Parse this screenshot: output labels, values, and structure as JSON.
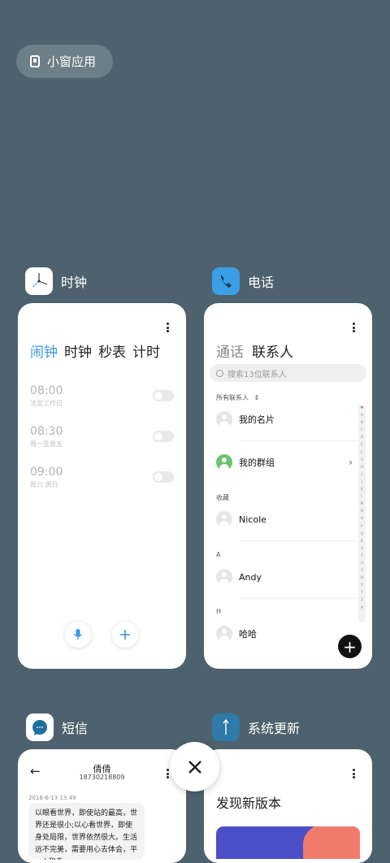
{
  "floating_window": {
    "label": "小窗应用"
  },
  "apps": {
    "clock": {
      "name": "时钟",
      "tabs": [
        "闹钟",
        "时钟",
        "秒表",
        "计时"
      ],
      "alarms": [
        {
          "time": "08:00",
          "desc": "法定工作日",
          "on": false
        },
        {
          "time": "08:30",
          "desc": "周一至周五",
          "on": false
        },
        {
          "time": "09:00",
          "desc": "周六 周日",
          "on": false
        }
      ]
    },
    "phone": {
      "name": "电话",
      "tabs": [
        "通话",
        "联系人"
      ],
      "search_placeholder": "搜索13位联系人",
      "section_all": "所有联系人",
      "my_card": "我的名片",
      "my_groups": "我的群组",
      "section_fav": "收藏",
      "contact_nicole": "Nicole",
      "section_a": "A",
      "contact_andy": "Andy",
      "section_h": "H",
      "contact_haha": "哈哈",
      "index_letters": [
        "♥",
        "A",
        "B",
        "C",
        "D",
        "E",
        "F",
        "G",
        "H",
        "I",
        "J",
        "K",
        "L",
        "M",
        "N",
        "O",
        "P",
        "Q",
        "R",
        "S",
        "T",
        "U",
        "V",
        "W",
        "X",
        "Y",
        "Z",
        "#"
      ]
    },
    "sms": {
      "name": "短信",
      "contact": "倩倩",
      "number": "18730218809",
      "date": "2016-6-13 13:49",
      "message": "以眼看世界，即使站的最高，世界还是很小;以心看世界，即使身处局限，世界依然很大。生活远不完美，需要用心去体会，平unk和去"
    },
    "update": {
      "name": "系统更新",
      "title": "发现新版本"
    }
  },
  "colors": {
    "background": "#4d626e",
    "accent": "#3a95e8",
    "phone_icon": "#3a9fe6",
    "update_icon": "#2e7aa8"
  }
}
